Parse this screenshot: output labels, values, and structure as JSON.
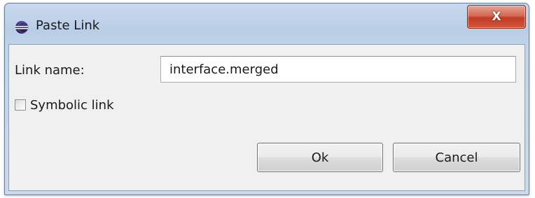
{
  "window": {
    "title": "Paste Link",
    "close_label": "X"
  },
  "form": {
    "link_name_label": "Link name:",
    "link_name_value": "interface.merged",
    "symbolic_link_label": "Symbolic link",
    "symbolic_link_checked": false
  },
  "buttons": {
    "ok_label": "Ok",
    "cancel_label": "Cancel"
  },
  "icons": {
    "app": "eclipse-icon",
    "close": "close-icon"
  },
  "colors": {
    "titlebar": "#c2d4ea",
    "close_button": "#c23b22",
    "client_bg": "#f0f0f0"
  }
}
